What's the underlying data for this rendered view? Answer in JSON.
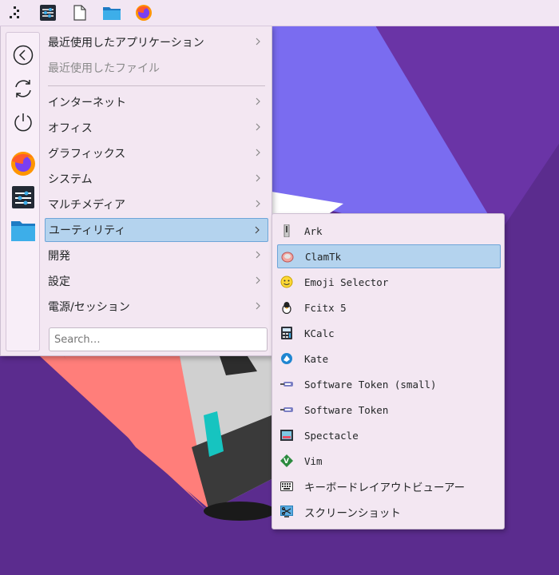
{
  "panel": {
    "launcher": {
      "icon": "application-launcher-icon"
    },
    "tasks": [
      {
        "icon": "system-settings-icon"
      },
      {
        "icon": "text-file-icon"
      },
      {
        "icon": "folder-icon"
      },
      {
        "icon": "firefox-icon"
      }
    ]
  },
  "sidebar": {
    "icons": [
      "back-icon",
      "refresh-icon",
      "power-icon",
      "firefox-icon",
      "settings-app-icon",
      "folder-icon"
    ]
  },
  "menu": {
    "items": [
      {
        "label": "最近使用したアプリケーション",
        "has_submenu": true
      },
      {
        "label": "最近使用したファイル",
        "disabled": true
      },
      {
        "label": "インターネット",
        "has_submenu": true
      },
      {
        "label": "オフィス",
        "has_submenu": true
      },
      {
        "label": "グラフィックス",
        "has_submenu": true
      },
      {
        "label": "システム",
        "has_submenu": true
      },
      {
        "label": "マルチメディア",
        "has_submenu": true
      },
      {
        "label": "ユーティリティ",
        "has_submenu": true,
        "selected": true
      },
      {
        "label": "開発",
        "has_submenu": true
      },
      {
        "label": "設定",
        "has_submenu": true
      },
      {
        "label": "電源/セッション",
        "has_submenu": true
      }
    ],
    "search_placeholder": "Search…"
  },
  "submenu": {
    "items": [
      {
        "label": "Ark",
        "icon": "ark-icon"
      },
      {
        "label": "ClamTk",
        "icon": "clamtk-icon",
        "selected": true
      },
      {
        "label": "Emoji Selector",
        "icon": "emoji-icon"
      },
      {
        "label": "Fcitx 5",
        "icon": "fcitx-icon"
      },
      {
        "label": "KCalc",
        "icon": "calculator-icon"
      },
      {
        "label": "Kate",
        "icon": "kate-icon"
      },
      {
        "label": "Software Token (small)",
        "icon": "software-token-icon"
      },
      {
        "label": "Software Token",
        "icon": "software-token-icon"
      },
      {
        "label": "Spectacle",
        "icon": "spectacle-icon"
      },
      {
        "label": "Vim",
        "icon": "vim-icon"
      },
      {
        "label": "キーボードレイアウトビューアー",
        "icon": "keyboard-icon"
      },
      {
        "label": "スクリーンショット",
        "icon": "screenshot-icon"
      }
    ]
  },
  "colors": {
    "selection": "#b4d3ee",
    "selection_border": "#6ea5d8",
    "menu_bg": "#f3e7f2",
    "wallpaper": "#5b2c8e"
  }
}
